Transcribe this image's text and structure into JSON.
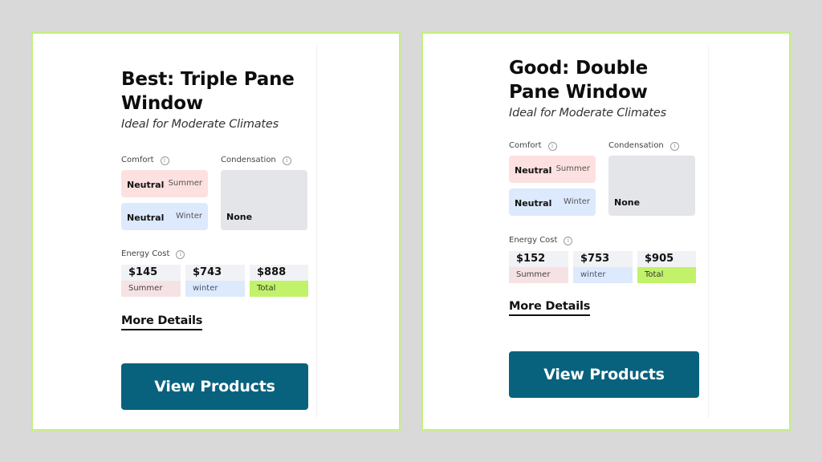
{
  "cards": [
    {
      "title": "Best: Triple Pane Window",
      "subtitle": "Ideal for Moderate Climates",
      "comfort": {
        "label": "Comfort",
        "summer": {
          "value": "Neutral",
          "season": "Summer"
        },
        "winter": {
          "value": "Neutral",
          "season": "Winter"
        }
      },
      "condensation": {
        "label": "Condensation",
        "value": "None"
      },
      "energy": {
        "label": "Energy Cost",
        "summer": {
          "amount": "$145",
          "tag": "Summer"
        },
        "winter": {
          "amount": "$743",
          "tag": "winter"
        },
        "total": {
          "amount": "$888",
          "tag": "Total"
        }
      },
      "more_details": "More Details",
      "button": "View Products"
    },
    {
      "title": "Good: Double Pane Window",
      "subtitle": "Ideal for Moderate Climates",
      "comfort": {
        "label": "Comfort",
        "summer": {
          "value": "Neutral",
          "season": "Summer"
        },
        "winter": {
          "value": "Neutral",
          "season": "Winter"
        }
      },
      "condensation": {
        "label": "Condensation",
        "value": "None"
      },
      "energy": {
        "label": "Energy Cost",
        "summer": {
          "amount": "$152",
          "tag": "Summer"
        },
        "winter": {
          "amount": "$753",
          "tag": "winter"
        },
        "total": {
          "amount": "$905",
          "tag": "Total"
        }
      },
      "more_details": "More Details",
      "button": "View Products"
    }
  ],
  "icons": {
    "info": "i"
  },
  "colors": {
    "card_border": "#c4f07a",
    "button_bg": "#08627d",
    "summer_bg": "#fde0e0",
    "winter_bg": "#dde9fc",
    "condensation_bg": "#e4e5e9",
    "total_bg": "#c1f26a",
    "page_bg": "#d9d9d9"
  }
}
